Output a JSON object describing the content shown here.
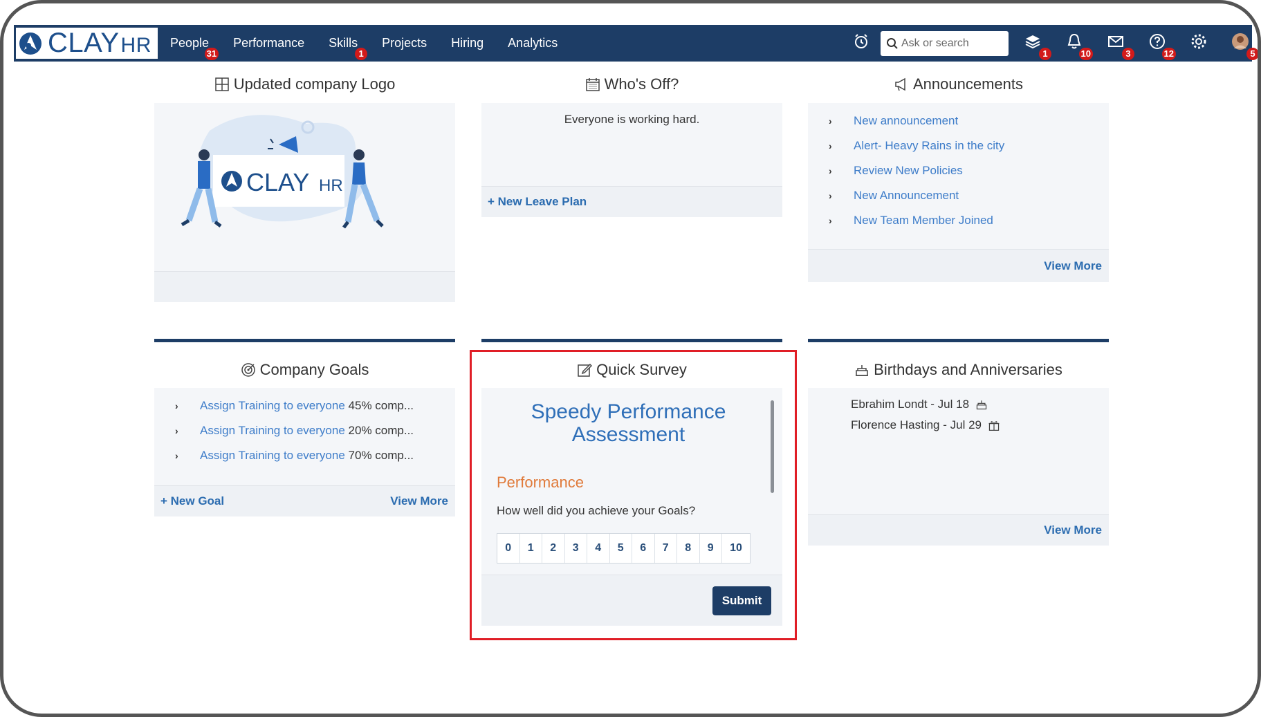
{
  "app": {
    "logo_text": "CLAY",
    "logo_suffix": "HR"
  },
  "nav": {
    "items": [
      {
        "label": "People",
        "badge": "31"
      },
      {
        "label": "Performance",
        "badge": ""
      },
      {
        "label": "Skills",
        "badge": "1"
      },
      {
        "label": "Projects",
        "badge": ""
      },
      {
        "label": "Hiring",
        "badge": ""
      },
      {
        "label": "Analytics",
        "badge": ""
      }
    ],
    "search_placeholder": "Ask or search",
    "icons": [
      {
        "name": "alarm-clock-icon",
        "badge": ""
      },
      {
        "name": "layers-icon",
        "badge": "1"
      },
      {
        "name": "bell-icon",
        "badge": "10"
      },
      {
        "name": "mail-icon",
        "badge": "3"
      },
      {
        "name": "help-icon",
        "badge": "12"
      },
      {
        "name": "gear-icon",
        "badge": ""
      },
      {
        "name": "avatar",
        "badge": "5"
      }
    ]
  },
  "logo_card": {
    "title": "Updated company Logo",
    "illustration_text": "CLAY",
    "illustration_suffix": "HR"
  },
  "whos_off": {
    "title": "Who's Off?",
    "message": "Everyone is working hard.",
    "action": "+ New Leave Plan"
  },
  "announcements": {
    "title": "Announcements",
    "items": [
      "New announcement",
      "Alert- Heavy Rains in the city",
      "Review New Policies",
      "New Announcement",
      "New Team Member Joined"
    ],
    "view_more": "View More"
  },
  "goals": {
    "title": "Company Goals",
    "items": [
      {
        "label": "Assign Training to everyone",
        "progress": "45% comp..."
      },
      {
        "label": "Assign Training to everyone",
        "progress": "20% comp..."
      },
      {
        "label": "Assign Training to everyone",
        "progress": "70% comp..."
      }
    ],
    "new_goal": "+ New Goal",
    "view_more": "View More"
  },
  "survey": {
    "title": "Quick Survey",
    "heading_line1": "Speedy Performance",
    "heading_line2": "Assessment",
    "section": "Performance",
    "question": "How well did you achieve your Goals?",
    "scale": [
      "0",
      "1",
      "2",
      "3",
      "4",
      "5",
      "6",
      "7",
      "8",
      "9",
      "10"
    ],
    "submit": "Submit"
  },
  "birthdays": {
    "title": "Birthdays and Anniversaries",
    "items": [
      {
        "label": "Ebrahim Londt - Jul 18",
        "icon": "cake-icon"
      },
      {
        "label": "Florence Hasting - Jul 29",
        "icon": "gift-icon"
      }
    ],
    "view_more": "View More"
  },
  "colors": {
    "nav_bg": "#1d3d66",
    "link": "#3d7cc9",
    "badge": "#d21a1a",
    "survey_highlight": "#e01e26",
    "section_orange": "#e07a3a"
  }
}
